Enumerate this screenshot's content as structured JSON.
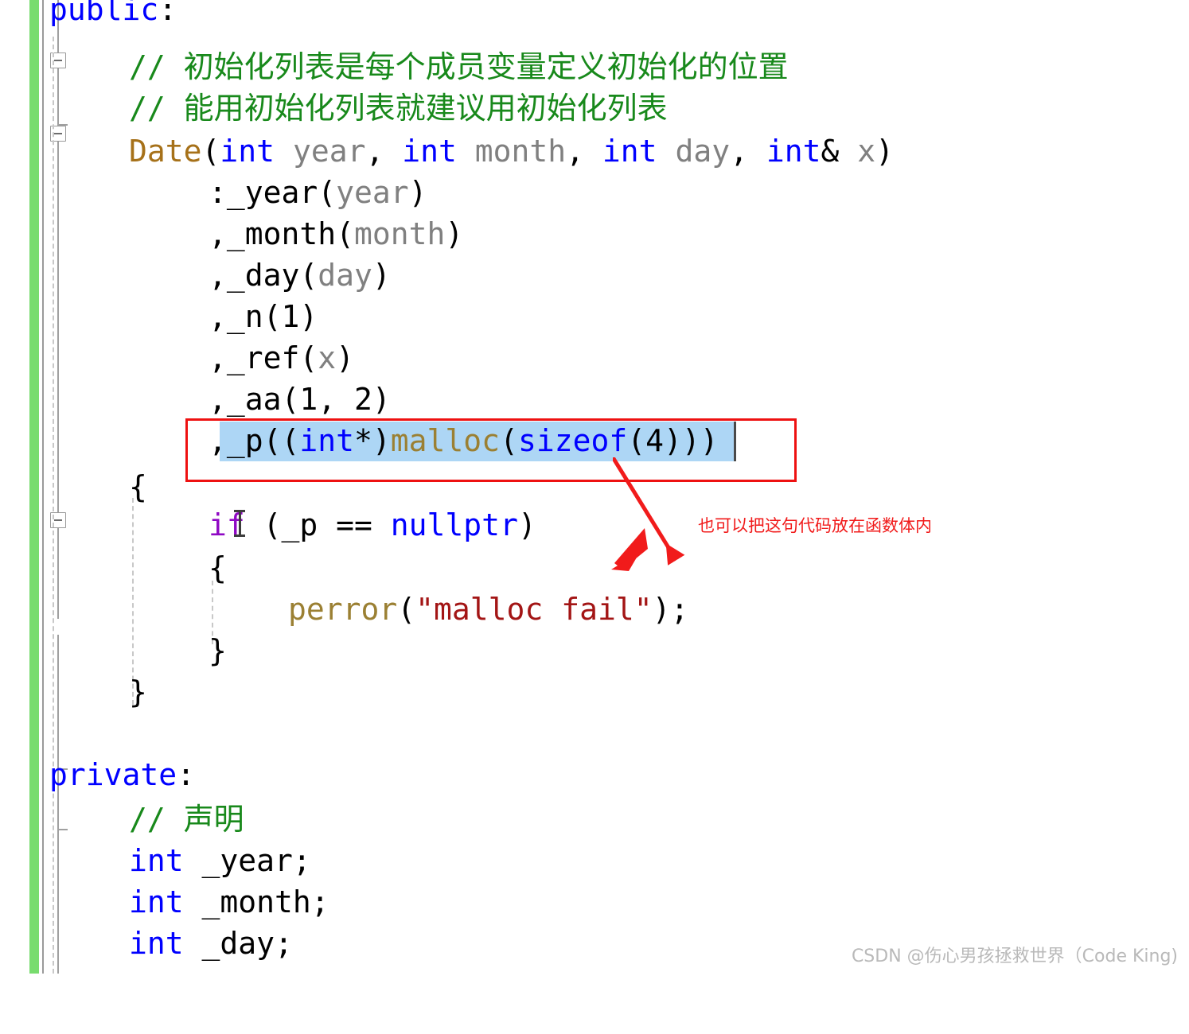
{
  "editor": {
    "language": "cpp",
    "background_color": "#ffffff",
    "font_size_px": 38,
    "line_height_px": 52,
    "change_bar_color": "#78dc6e",
    "selection_color": "#add6f5",
    "annotation_color": "#ee1111"
  },
  "gutter": {
    "change_bar_name": "unsaved-changes-bar",
    "collapse_boxes": [
      {
        "name": "collapse-box-1",
        "state": "expanded",
        "glyph": "minus"
      },
      {
        "name": "collapse-box-2",
        "state": "expanded",
        "glyph": "minus"
      },
      {
        "name": "collapse-box-3",
        "state": "expanded",
        "glyph": "minus"
      }
    ]
  },
  "code_lines": [
    {
      "id": "line-public",
      "indent": 0,
      "tokens": [
        {
          "text": "public",
          "cls": "kw"
        },
        {
          "text": ":",
          "cls": "ident"
        }
      ]
    },
    {
      "id": "line-comment-1",
      "indent": 1,
      "tokens": [
        {
          "text": "// ",
          "cls": "cmt"
        },
        {
          "text": "初始化列表是每个成员变量定义初始化的位置",
          "cls": "cmt cjk"
        }
      ]
    },
    {
      "id": "line-comment-2",
      "indent": 1,
      "tokens": [
        {
          "text": "// ",
          "cls": "cmt"
        },
        {
          "text": "能用初始化列表就建议用初始化列表",
          "cls": "cmt cjk"
        }
      ]
    },
    {
      "id": "line-ctor-signature",
      "indent": 1,
      "tokens": [
        {
          "text": "Date",
          "cls": "type"
        },
        {
          "text": "(",
          "cls": "ident"
        },
        {
          "text": "int",
          "cls": "kw"
        },
        {
          "text": " ",
          "cls": "ident"
        },
        {
          "text": "year",
          "cls": "param"
        },
        {
          "text": ", ",
          "cls": "ident"
        },
        {
          "text": "int",
          "cls": "kw"
        },
        {
          "text": " ",
          "cls": "ident"
        },
        {
          "text": "month",
          "cls": "param"
        },
        {
          "text": ", ",
          "cls": "ident"
        },
        {
          "text": "int",
          "cls": "kw"
        },
        {
          "text": " ",
          "cls": "ident"
        },
        {
          "text": "day",
          "cls": "param"
        },
        {
          "text": ", ",
          "cls": "ident"
        },
        {
          "text": "int",
          "cls": "kw"
        },
        {
          "text": "& ",
          "cls": "ident"
        },
        {
          "text": "x",
          "cls": "param"
        },
        {
          "text": ")",
          "cls": "ident"
        }
      ]
    },
    {
      "id": "line-init-year",
      "indent": 2,
      "tokens": [
        {
          "text": ":_year(",
          "cls": "ident"
        },
        {
          "text": "year",
          "cls": "param"
        },
        {
          "text": ")",
          "cls": "ident"
        }
      ]
    },
    {
      "id": "line-init-month",
      "indent": 2,
      "tokens": [
        {
          "text": ",_month(",
          "cls": "ident"
        },
        {
          "text": "month",
          "cls": "param"
        },
        {
          "text": ")",
          "cls": "ident"
        }
      ]
    },
    {
      "id": "line-init-day",
      "indent": 2,
      "tokens": [
        {
          "text": ",_day(",
          "cls": "ident"
        },
        {
          "text": "day",
          "cls": "param"
        },
        {
          "text": ")",
          "cls": "ident"
        }
      ]
    },
    {
      "id": "line-init-n",
      "indent": 2,
      "tokens": [
        {
          "text": ",_n(1)",
          "cls": "ident"
        }
      ]
    },
    {
      "id": "line-init-ref",
      "indent": 2,
      "tokens": [
        {
          "text": ",_ref(",
          "cls": "ident"
        },
        {
          "text": "x",
          "cls": "param"
        },
        {
          "text": ")",
          "cls": "ident"
        }
      ]
    },
    {
      "id": "line-init-aa",
      "indent": 2,
      "tokens": [
        {
          "text": ",_aa(1, 2)",
          "cls": "ident"
        }
      ]
    },
    {
      "id": "line-init-p",
      "indent": 2,
      "selected": true,
      "tokens": [
        {
          "text": ",_p((",
          "cls": "ident"
        },
        {
          "text": "int",
          "cls": "kw"
        },
        {
          "text": "*)",
          "cls": "ident"
        },
        {
          "text": "malloc",
          "cls": "fn"
        },
        {
          "text": "(",
          "cls": "ident"
        },
        {
          "text": "sizeof",
          "cls": "kw"
        },
        {
          "text": "(4)))",
          "cls": "ident"
        }
      ]
    },
    {
      "id": "line-ctor-open-brace",
      "indent": 1,
      "tokens": [
        {
          "text": "{",
          "cls": "ident"
        }
      ]
    },
    {
      "id": "line-if-nullptr",
      "indent": 2,
      "tokens": [
        {
          "text": "if",
          "cls": "kw2"
        },
        {
          "text": " (_p == ",
          "cls": "ident"
        },
        {
          "text": "nullptr",
          "cls": "kw"
        },
        {
          "text": ")",
          "cls": "ident"
        }
      ]
    },
    {
      "id": "line-if-open-brace",
      "indent": 2,
      "tokens": [
        {
          "text": "{",
          "cls": "ident"
        }
      ]
    },
    {
      "id": "line-perror",
      "indent": 3,
      "tokens": [
        {
          "text": "perror",
          "cls": "fn"
        },
        {
          "text": "(",
          "cls": "ident"
        },
        {
          "text": "\"malloc fail\"",
          "cls": "str"
        },
        {
          "text": ");",
          "cls": "ident"
        }
      ]
    },
    {
      "id": "line-if-close-brace",
      "indent": 2,
      "tokens": [
        {
          "text": "}",
          "cls": "ident"
        }
      ]
    },
    {
      "id": "line-ctor-close-brace",
      "indent": 1,
      "tokens": [
        {
          "text": "}",
          "cls": "ident"
        }
      ]
    },
    {
      "id": "line-blank-1",
      "indent": 0,
      "tokens": []
    },
    {
      "id": "line-private",
      "indent": 0,
      "tokens": [
        {
          "text": "private",
          "cls": "kw"
        },
        {
          "text": ":",
          "cls": "ident"
        }
      ]
    },
    {
      "id": "line-comment-3",
      "indent": 1,
      "tokens": [
        {
          "text": "// ",
          "cls": "cmt"
        },
        {
          "text": "声明",
          "cls": "cmt cjk"
        }
      ]
    },
    {
      "id": "line-member-year",
      "indent": 1,
      "tokens": [
        {
          "text": "int",
          "cls": "kw"
        },
        {
          "text": " _year;",
          "cls": "ident"
        }
      ]
    },
    {
      "id": "line-member-month",
      "indent": 1,
      "tokens": [
        {
          "text": "int",
          "cls": "kw"
        },
        {
          "text": " _month;",
          "cls": "ident"
        }
      ]
    },
    {
      "id": "line-member-day",
      "indent": 1,
      "tokens": [
        {
          "text": "int",
          "cls": "kw"
        },
        {
          "text": " _day;",
          "cls": "ident"
        }
      ]
    }
  ],
  "annotation": {
    "note_text": "也可以把这句代码放在函数体内",
    "color": "#f11b1b",
    "highlighted_code": ",_p((int*)malloc(sizeof(4)))"
  },
  "watermark": {
    "text": "CSDN @伤心男孩拯救世界（Code King)"
  }
}
